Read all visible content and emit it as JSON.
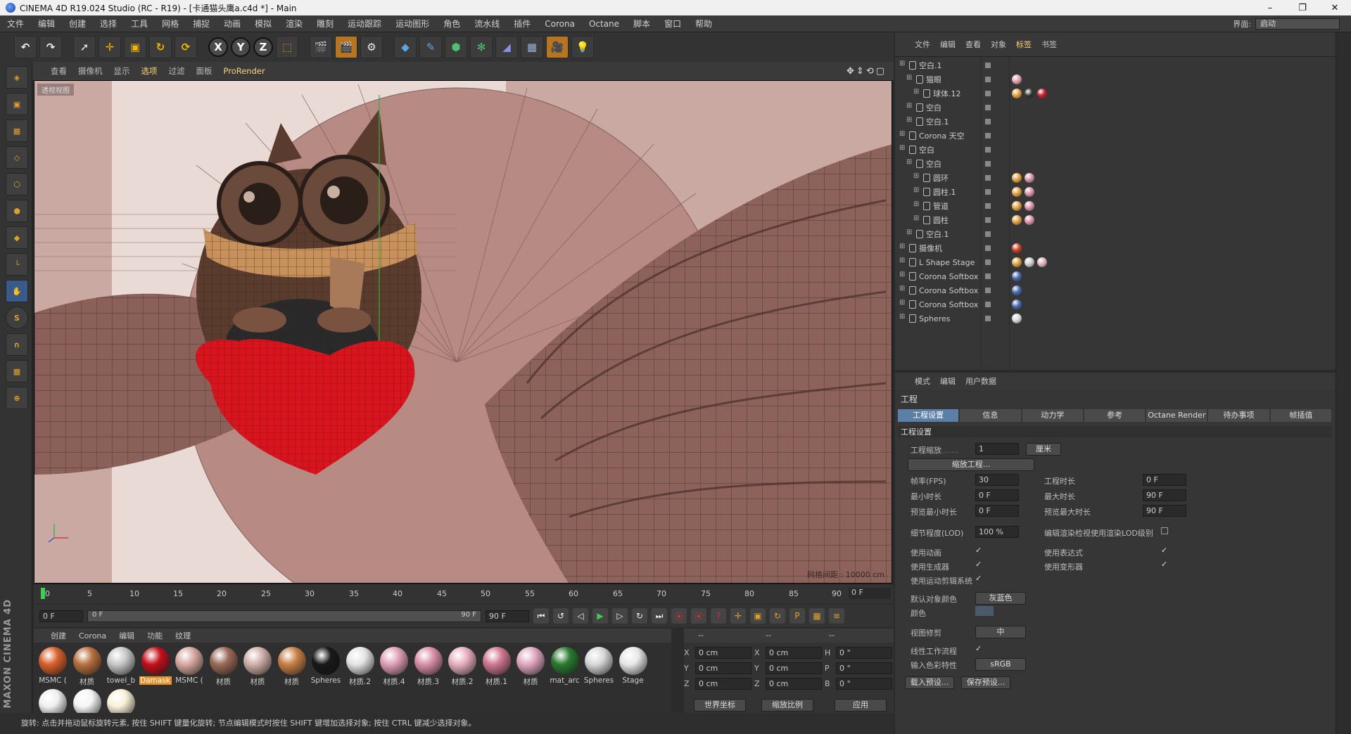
{
  "window": {
    "title": "CINEMA 4D R19.024 Studio (RC - R19) - [卡通猫头鹰a.c4d *] - Main",
    "controls": [
      "–",
      "❐",
      "✕"
    ]
  },
  "menubar": {
    "items": [
      "文件",
      "编辑",
      "创建",
      "选择",
      "工具",
      "网格",
      "捕捉",
      "动画",
      "模拟",
      "渲染",
      "雕刻",
      "运动跟踪",
      "运动图形",
      "角色",
      "流水线",
      "插件",
      "Corona",
      "Octane",
      "脚本",
      "窗口",
      "帮助"
    ],
    "layout_label": "界面:",
    "layout_value": "启动"
  },
  "toolbar": {
    "axes": [
      "X",
      "Y",
      "Z"
    ]
  },
  "viewport": {
    "menu": [
      "查看",
      "摄像机",
      "显示",
      "选项",
      "过滤",
      "面板",
      "ProRender"
    ],
    "active_menu": "ProRender",
    "camera_label": "透视视图",
    "grid_info": "网格间距 : 10000 cm"
  },
  "timeline": {
    "ticks": [
      "0",
      "5",
      "10",
      "15",
      "20",
      "25",
      "30",
      "35",
      "40",
      "45",
      "50",
      "55",
      "60",
      "65",
      "70",
      "75",
      "80",
      "85",
      "90"
    ],
    "current_frame": "0 F",
    "start_field": "0 F",
    "range_start": "0 F",
    "range_end": "90 F",
    "end_field": "90 F"
  },
  "material_manager": {
    "menu": [
      "创建",
      "Corona",
      "编辑",
      "功能",
      "纹理"
    ],
    "materials": [
      {
        "name": "MSMC (",
        "color": "#d8602c"
      },
      {
        "name": "材质",
        "color": "#b87040"
      },
      {
        "name": "towel_b",
        "color": "#c8c8c8"
      },
      {
        "name": "Damask",
        "color": "#c4101c",
        "selected": true
      },
      {
        "name": "MSMC (",
        "color": "#d8a8a0"
      },
      {
        "name": "材质",
        "color": "#9a6a58"
      },
      {
        "name": "材质",
        "color": "#d0b0a8"
      },
      {
        "name": "材质",
        "color": "#c88048"
      },
      {
        "name": "Spheres",
        "color": "#181818"
      },
      {
        "name": "材质.2",
        "color": "#e4e4e4"
      },
      {
        "name": "材质.4",
        "color": "#e0a0b8"
      },
      {
        "name": "材质.3",
        "color": "#d890a8"
      },
      {
        "name": "材质.2",
        "color": "#e8b0c0"
      },
      {
        "name": "材质.1",
        "color": "#d07890"
      },
      {
        "name": "材质",
        "color": "#e0a8c0"
      },
      {
        "name": "mat_arc",
        "color": "#2a7a30"
      },
      {
        "name": "Spheres",
        "color": "#d8d8d8"
      },
      {
        "name": "Stage",
        "color": "#e8e8e8"
      }
    ],
    "row2": [
      {
        "name": "",
        "color": "#f0f0f0"
      },
      {
        "name": "",
        "color": "#f4f4f4"
      },
      {
        "name": "",
        "color": "#f8f0d8"
      }
    ]
  },
  "coordinates": {
    "headers": [
      "--",
      "--",
      "--"
    ],
    "rows": [
      {
        "a": "X",
        "av": "0 cm",
        "b": "X",
        "bv": "0 cm",
        "c": "H",
        "cv": "0 °"
      },
      {
        "a": "Y",
        "av": "0 cm",
        "b": "Y",
        "bv": "0 cm",
        "c": "P",
        "cv": "0 °"
      },
      {
        "a": "Z",
        "av": "0 cm",
        "b": "Z",
        "bv": "0 cm",
        "c": "B",
        "cv": "0 °"
      }
    ],
    "mode1": "世界坐标",
    "mode2": "缩放比例",
    "apply": "应用"
  },
  "status": "旋转: 点击并拖动鼠标旋转元素, 按住 SHIFT 键量化旋转; 节点编辑模式时按住 SHIFT 键增加选择对象; 按住 CTRL 键减少选择对象。",
  "object_manager": {
    "menu": [
      "文件",
      "编辑",
      "查看",
      "对象",
      "标签",
      "书签"
    ],
    "active_menu": "标签",
    "objects": [
      {
        "indent": 0,
        "name": "空白.1",
        "tags": []
      },
      {
        "indent": 1,
        "name": "猫眼",
        "tags": [
          "#e0a0a8"
        ]
      },
      {
        "indent": 2,
        "name": "球体.12",
        "tags": [
          "#e0a040",
          "#333",
          "#c41c2c"
        ]
      },
      {
        "indent": 1,
        "name": "空白",
        "tags": []
      },
      {
        "indent": 1,
        "name": "空白.1",
        "tags": []
      },
      {
        "indent": 0,
        "name": "Corona 天空",
        "tags": []
      },
      {
        "indent": 0,
        "name": "空白",
        "tags": []
      },
      {
        "indent": 1,
        "name": "空白",
        "tags": []
      },
      {
        "indent": 2,
        "name": "圆环",
        "tags": [
          "#e0a040",
          "#d890a8"
        ]
      },
      {
        "indent": 2,
        "name": "圆柱.1",
        "tags": [
          "#e0a040",
          "#d890a8"
        ]
      },
      {
        "indent": 2,
        "name": "管道",
        "tags": [
          "#e0a040",
          "#d890a8"
        ]
      },
      {
        "indent": 2,
        "name": "圆柱",
        "tags": [
          "#e0a040",
          "#d890a8"
        ]
      },
      {
        "indent": 1,
        "name": "空白.1",
        "tags": []
      },
      {
        "indent": 0,
        "name": "摄像机",
        "tags": [
          "#d04020"
        ]
      },
      {
        "indent": 0,
        "name": "L Shape Stage",
        "tags": [
          "#e0a040",
          "#cccccc",
          "#e0b0b8"
        ]
      },
      {
        "indent": 0,
        "name": "Corona Softbox",
        "tags": [
          "#4a6ab0"
        ]
      },
      {
        "indent": 0,
        "name": "Corona Softbox",
        "tags": [
          "#4a6ab0"
        ]
      },
      {
        "indent": 0,
        "name": "Corona Softbox",
        "tags": [
          "#4a6ab0"
        ]
      },
      {
        "indent": 0,
        "name": "Spheres",
        "tags": [
          "#d8d8d8"
        ]
      }
    ]
  },
  "attribute_manager": {
    "menu": [
      "模式",
      "编辑",
      "用户数据"
    ],
    "title": "工程",
    "tabs": [
      "工程设置",
      "信息",
      "动力学",
      "参考",
      "Octane Render",
      "待办事项",
      "帧插值"
    ],
    "active_tab": "工程设置",
    "group": "工程设置",
    "scale_label": "工程缩放",
    "scale_value": "1",
    "scale_unit": "厘米",
    "scale_button": "缩放工程...",
    "fps_label": "帧率(FPS)",
    "fps_value": "30",
    "duration_label": "工程时长",
    "duration_value": "0 F",
    "min_time_label": "最小时长",
    "min_time_value": "0 F",
    "max_time_label": "最大时长",
    "max_time_value": "90 F",
    "preview_min_label": "预览最小时长",
    "preview_min_value": "0 F",
    "preview_max_label": "预览最大时长",
    "preview_max_value": "90 F",
    "lod_label": "细节程度(LOD)",
    "lod_value": "100 %",
    "render_lod_label": "编辑渲染检视使用渲染LOD级别",
    "use_anim_label": "使用动画",
    "use_expr_label": "使用表达式",
    "use_gen_label": "使用生成器",
    "use_deform_label": "使用变形器",
    "use_motion_label": "使用运动剪辑系统",
    "default_color_label": "默认对象颜色",
    "default_color_value": "灰蓝色",
    "color_label": "颜色",
    "view_clip_label": "视图修剪",
    "view_clip_value": "中",
    "linear_label": "线性工作流程",
    "input_color_label": "输入色彩特性",
    "input_color_value": "sRGB",
    "load_preset": "载入预设...",
    "save_preset": "保存预设..."
  },
  "colors": {
    "accent": "#5b7fa6",
    "highlight": "#ffd479",
    "selected_material": "#e8902a"
  }
}
